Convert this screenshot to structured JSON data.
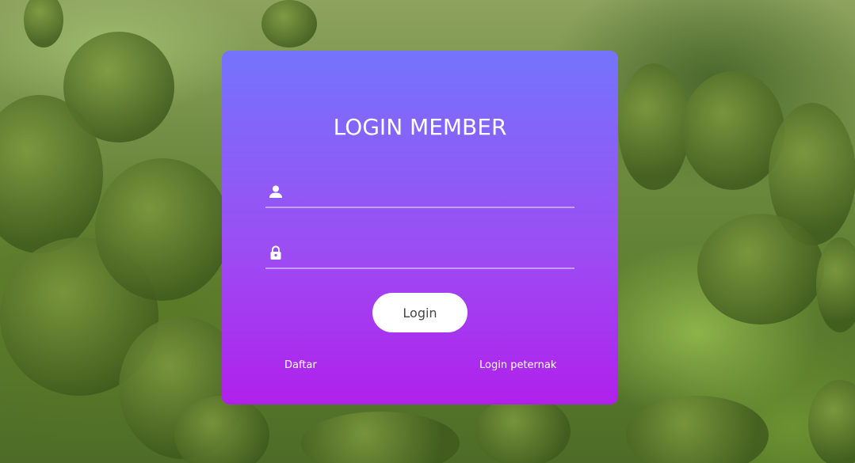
{
  "form": {
    "title": "LOGIN MEMBER",
    "username": {
      "icon": "user-icon",
      "value": "",
      "placeholder": ""
    },
    "password": {
      "icon": "lock-icon",
      "value": "",
      "placeholder": ""
    },
    "login_label": "Login"
  },
  "links": {
    "register_label": "Daftar",
    "farmer_login_label": "Login peternak"
  },
  "colors": {
    "card_gradient_top": "#7474fd",
    "card_gradient_bottom": "#b020ec",
    "button_bg": "#ffffff",
    "text": "#ffffff"
  }
}
